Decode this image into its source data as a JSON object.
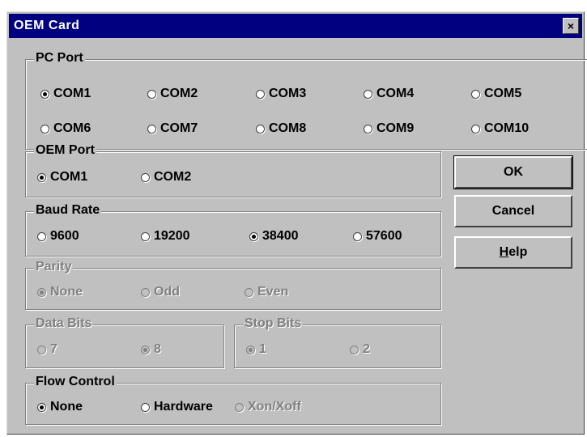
{
  "window": {
    "title": "OEM Card",
    "close_glyph": "×"
  },
  "pc_port": {
    "label": "PC Port",
    "options": [
      "COM1",
      "COM2",
      "COM3",
      "COM4",
      "COM5",
      "COM6",
      "COM7",
      "COM8",
      "COM9",
      "COM10"
    ],
    "selected": "COM1"
  },
  "oem_port": {
    "label": "OEM Port",
    "options": [
      "COM1",
      "COM2"
    ],
    "selected": "COM1"
  },
  "baud_rate": {
    "label": "Baud Rate",
    "options": [
      "9600",
      "19200",
      "38400",
      "57600"
    ],
    "selected": "38400"
  },
  "parity": {
    "label": "Parity",
    "options": [
      "None",
      "Odd",
      "Even"
    ],
    "selected": "None"
  },
  "data_bits": {
    "label": "Data Bits",
    "options": [
      "7",
      "8"
    ],
    "selected": "8"
  },
  "stop_bits": {
    "label": "Stop Bits",
    "options": [
      "1",
      "2"
    ],
    "selected": "1"
  },
  "flow_control": {
    "label": "Flow Control",
    "options": [
      "None",
      "Hardware",
      "Xon/Xoff"
    ],
    "selected": "None"
  },
  "buttons": {
    "ok": "OK",
    "cancel": "Cancel",
    "help_prefix": "H",
    "help_rest": "elp"
  }
}
